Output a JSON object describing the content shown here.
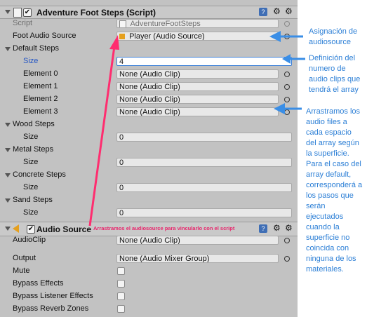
{
  "script_component": {
    "title": "Adventure Foot Steps (Script)",
    "script_label": "Script",
    "script_value": "AdventureFootSteps",
    "foot_audio_label": "Foot Audio Source",
    "foot_audio_value": "Player (Audio Source)",
    "default_steps_label": "Default Steps",
    "size_label": "Size",
    "default_size_value": "4",
    "elements": [
      {
        "label": "Element 0",
        "value": "None (Audio Clip)"
      },
      {
        "label": "Element 1",
        "value": "None (Audio Clip)"
      },
      {
        "label": "Element 2",
        "value": "None (Audio Clip)"
      },
      {
        "label": "Element 3",
        "value": "None (Audio Clip)"
      }
    ],
    "groups": [
      {
        "label": "Wood Steps",
        "size": "0"
      },
      {
        "label": "Metal Steps",
        "size": "0"
      },
      {
        "label": "Concrete Steps",
        "size": "0"
      },
      {
        "label": "Sand Steps",
        "size": "0"
      }
    ]
  },
  "audio_component": {
    "title": "Audio Source",
    "audioclip_label": "AudioClip",
    "audioclip_value": "None (Audio Clip)",
    "output_label": "Output",
    "output_value": "None (Audio Mixer Group)",
    "toggles": [
      "Mute",
      "Bypass Effects",
      "Bypass Listener Effects",
      "Bypass Reverb Zones"
    ]
  },
  "annotations": {
    "assignment": [
      "Asignación de",
      "audiosource"
    ],
    "definition": [
      "Definición del",
      "numero de",
      "audio clips que",
      "tendrá el array"
    ],
    "drag_files": [
      "Arrastramos los",
      "audio files a",
      "cada espacio",
      "del array según",
      "la superficie.",
      "Para el caso del",
      "array default,",
      "corresponderá a",
      "los pasos que",
      "serán",
      "ejecutados",
      "cuando la",
      "superficie no",
      "coincida con",
      "ninguna de los",
      "materiales."
    ],
    "drag_source": "Arrastramos el audiosource para vincularlo con el script"
  },
  "colors": {
    "annotation_blue": "#2c7fd6",
    "arrow_pink": "#ff2d6f",
    "arrow_blue": "#3a8ee6"
  }
}
